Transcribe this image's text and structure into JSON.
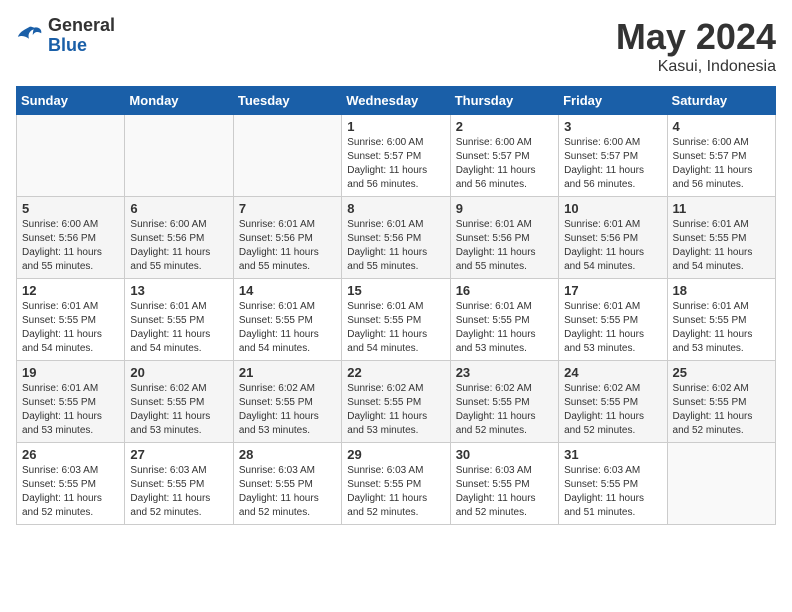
{
  "header": {
    "logo_general": "General",
    "logo_blue": "Blue",
    "month_title": "May 2024",
    "location": "Kasui, Indonesia"
  },
  "weekdays": [
    "Sunday",
    "Monday",
    "Tuesday",
    "Wednesday",
    "Thursday",
    "Friday",
    "Saturday"
  ],
  "weeks": [
    [
      {
        "day": "",
        "sunrise": "",
        "sunset": "",
        "daylight": ""
      },
      {
        "day": "",
        "sunrise": "",
        "sunset": "",
        "daylight": ""
      },
      {
        "day": "",
        "sunrise": "",
        "sunset": "",
        "daylight": ""
      },
      {
        "day": "1",
        "sunrise": "Sunrise: 6:00 AM",
        "sunset": "Sunset: 5:57 PM",
        "daylight": "Daylight: 11 hours and 56 minutes."
      },
      {
        "day": "2",
        "sunrise": "Sunrise: 6:00 AM",
        "sunset": "Sunset: 5:57 PM",
        "daylight": "Daylight: 11 hours and 56 minutes."
      },
      {
        "day": "3",
        "sunrise": "Sunrise: 6:00 AM",
        "sunset": "Sunset: 5:57 PM",
        "daylight": "Daylight: 11 hours and 56 minutes."
      },
      {
        "day": "4",
        "sunrise": "Sunrise: 6:00 AM",
        "sunset": "Sunset: 5:57 PM",
        "daylight": "Daylight: 11 hours and 56 minutes."
      }
    ],
    [
      {
        "day": "5",
        "sunrise": "Sunrise: 6:00 AM",
        "sunset": "Sunset: 5:56 PM",
        "daylight": "Daylight: 11 hours and 55 minutes."
      },
      {
        "day": "6",
        "sunrise": "Sunrise: 6:00 AM",
        "sunset": "Sunset: 5:56 PM",
        "daylight": "Daylight: 11 hours and 55 minutes."
      },
      {
        "day": "7",
        "sunrise": "Sunrise: 6:01 AM",
        "sunset": "Sunset: 5:56 PM",
        "daylight": "Daylight: 11 hours and 55 minutes."
      },
      {
        "day": "8",
        "sunrise": "Sunrise: 6:01 AM",
        "sunset": "Sunset: 5:56 PM",
        "daylight": "Daylight: 11 hours and 55 minutes."
      },
      {
        "day": "9",
        "sunrise": "Sunrise: 6:01 AM",
        "sunset": "Sunset: 5:56 PM",
        "daylight": "Daylight: 11 hours and 55 minutes."
      },
      {
        "day": "10",
        "sunrise": "Sunrise: 6:01 AM",
        "sunset": "Sunset: 5:56 PM",
        "daylight": "Daylight: 11 hours and 54 minutes."
      },
      {
        "day": "11",
        "sunrise": "Sunrise: 6:01 AM",
        "sunset": "Sunset: 5:55 PM",
        "daylight": "Daylight: 11 hours and 54 minutes."
      }
    ],
    [
      {
        "day": "12",
        "sunrise": "Sunrise: 6:01 AM",
        "sunset": "Sunset: 5:55 PM",
        "daylight": "Daylight: 11 hours and 54 minutes."
      },
      {
        "day": "13",
        "sunrise": "Sunrise: 6:01 AM",
        "sunset": "Sunset: 5:55 PM",
        "daylight": "Daylight: 11 hours and 54 minutes."
      },
      {
        "day": "14",
        "sunrise": "Sunrise: 6:01 AM",
        "sunset": "Sunset: 5:55 PM",
        "daylight": "Daylight: 11 hours and 54 minutes."
      },
      {
        "day": "15",
        "sunrise": "Sunrise: 6:01 AM",
        "sunset": "Sunset: 5:55 PM",
        "daylight": "Daylight: 11 hours and 54 minutes."
      },
      {
        "day": "16",
        "sunrise": "Sunrise: 6:01 AM",
        "sunset": "Sunset: 5:55 PM",
        "daylight": "Daylight: 11 hours and 53 minutes."
      },
      {
        "day": "17",
        "sunrise": "Sunrise: 6:01 AM",
        "sunset": "Sunset: 5:55 PM",
        "daylight": "Daylight: 11 hours and 53 minutes."
      },
      {
        "day": "18",
        "sunrise": "Sunrise: 6:01 AM",
        "sunset": "Sunset: 5:55 PM",
        "daylight": "Daylight: 11 hours and 53 minutes."
      }
    ],
    [
      {
        "day": "19",
        "sunrise": "Sunrise: 6:01 AM",
        "sunset": "Sunset: 5:55 PM",
        "daylight": "Daylight: 11 hours and 53 minutes."
      },
      {
        "day": "20",
        "sunrise": "Sunrise: 6:02 AM",
        "sunset": "Sunset: 5:55 PM",
        "daylight": "Daylight: 11 hours and 53 minutes."
      },
      {
        "day": "21",
        "sunrise": "Sunrise: 6:02 AM",
        "sunset": "Sunset: 5:55 PM",
        "daylight": "Daylight: 11 hours and 53 minutes."
      },
      {
        "day": "22",
        "sunrise": "Sunrise: 6:02 AM",
        "sunset": "Sunset: 5:55 PM",
        "daylight": "Daylight: 11 hours and 53 minutes."
      },
      {
        "day": "23",
        "sunrise": "Sunrise: 6:02 AM",
        "sunset": "Sunset: 5:55 PM",
        "daylight": "Daylight: 11 hours and 52 minutes."
      },
      {
        "day": "24",
        "sunrise": "Sunrise: 6:02 AM",
        "sunset": "Sunset: 5:55 PM",
        "daylight": "Daylight: 11 hours and 52 minutes."
      },
      {
        "day": "25",
        "sunrise": "Sunrise: 6:02 AM",
        "sunset": "Sunset: 5:55 PM",
        "daylight": "Daylight: 11 hours and 52 minutes."
      }
    ],
    [
      {
        "day": "26",
        "sunrise": "Sunrise: 6:03 AM",
        "sunset": "Sunset: 5:55 PM",
        "daylight": "Daylight: 11 hours and 52 minutes."
      },
      {
        "day": "27",
        "sunrise": "Sunrise: 6:03 AM",
        "sunset": "Sunset: 5:55 PM",
        "daylight": "Daylight: 11 hours and 52 minutes."
      },
      {
        "day": "28",
        "sunrise": "Sunrise: 6:03 AM",
        "sunset": "Sunset: 5:55 PM",
        "daylight": "Daylight: 11 hours and 52 minutes."
      },
      {
        "day": "29",
        "sunrise": "Sunrise: 6:03 AM",
        "sunset": "Sunset: 5:55 PM",
        "daylight": "Daylight: 11 hours and 52 minutes."
      },
      {
        "day": "30",
        "sunrise": "Sunrise: 6:03 AM",
        "sunset": "Sunset: 5:55 PM",
        "daylight": "Daylight: 11 hours and 52 minutes."
      },
      {
        "day": "31",
        "sunrise": "Sunrise: 6:03 AM",
        "sunset": "Sunset: 5:55 PM",
        "daylight": "Daylight: 11 hours and 51 minutes."
      },
      {
        "day": "",
        "sunrise": "",
        "sunset": "",
        "daylight": ""
      }
    ]
  ]
}
